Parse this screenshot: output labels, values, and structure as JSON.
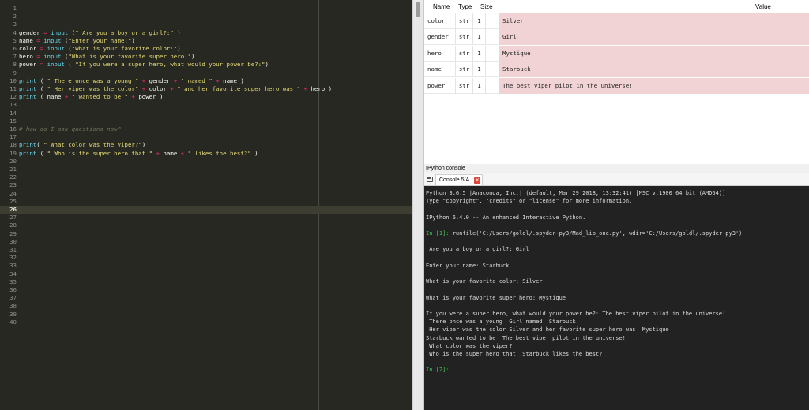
{
  "editor": {
    "current_line": 26,
    "lines": [
      {
        "n": "1",
        "tokens": []
      },
      {
        "n": "2",
        "tokens": []
      },
      {
        "n": "3",
        "tokens": []
      },
      {
        "n": "4",
        "tokens": [
          {
            "t": "gender ",
            "c": "t"
          },
          {
            "t": "=",
            "c": "o"
          },
          {
            "t": " ",
            "c": "t"
          },
          {
            "t": "input",
            "c": "k"
          },
          {
            "t": " (",
            "c": "t"
          },
          {
            "t": "\" Are you a boy or a girl?:\"",
            "c": "s"
          },
          {
            "t": " )",
            "c": "t"
          }
        ]
      },
      {
        "n": "5",
        "tokens": [
          {
            "t": "name ",
            "c": "t"
          },
          {
            "t": "=",
            "c": "o"
          },
          {
            "t": " ",
            "c": "t"
          },
          {
            "t": "input",
            "c": "k"
          },
          {
            "t": " (",
            "c": "t"
          },
          {
            "t": "\"Enter your name:\"",
            "c": "s"
          },
          {
            "t": ")",
            "c": "t"
          }
        ]
      },
      {
        "n": "6",
        "tokens": [
          {
            "t": "color ",
            "c": "t"
          },
          {
            "t": "=",
            "c": "o"
          },
          {
            "t": " ",
            "c": "t"
          },
          {
            "t": "input",
            "c": "k"
          },
          {
            "t": " (",
            "c": "t"
          },
          {
            "t": "\"What is your favorite color:\"",
            "c": "s"
          },
          {
            "t": ")",
            "c": "t"
          }
        ]
      },
      {
        "n": "7",
        "tokens": [
          {
            "t": "hero ",
            "c": "t"
          },
          {
            "t": "=",
            "c": "o"
          },
          {
            "t": " ",
            "c": "t"
          },
          {
            "t": "input",
            "c": "k"
          },
          {
            "t": " (",
            "c": "t"
          },
          {
            "t": "\"What is your favorite super hero:\"",
            "c": "s"
          },
          {
            "t": ")",
            "c": "t"
          }
        ]
      },
      {
        "n": "8",
        "tokens": [
          {
            "t": "power ",
            "c": "t"
          },
          {
            "t": "=",
            "c": "o"
          },
          {
            "t": " ",
            "c": "t"
          },
          {
            "t": "input",
            "c": "k"
          },
          {
            "t": " ( ",
            "c": "t"
          },
          {
            "t": "\"If you were a super hero, what would your power be?:\"",
            "c": "s"
          },
          {
            "t": ")",
            "c": "t"
          }
        ]
      },
      {
        "n": "9",
        "tokens": []
      },
      {
        "n": "10",
        "tokens": [
          {
            "t": "print",
            "c": "k"
          },
          {
            "t": " ( ",
            "c": "t"
          },
          {
            "t": "\" There once was a young \"",
            "c": "s"
          },
          {
            "t": " ",
            "c": "t"
          },
          {
            "t": "+",
            "c": "o"
          },
          {
            "t": " gender ",
            "c": "t"
          },
          {
            "t": "+",
            "c": "o"
          },
          {
            "t": " ",
            "c": "t"
          },
          {
            "t": "\" named \"",
            "c": "s"
          },
          {
            "t": " ",
            "c": "t"
          },
          {
            "t": "+",
            "c": "o"
          },
          {
            "t": " name )",
            "c": "t"
          }
        ]
      },
      {
        "n": "11",
        "tokens": [
          {
            "t": "print",
            "c": "k"
          },
          {
            "t": " ( ",
            "c": "t"
          },
          {
            "t": "\" Her viper was the color\"",
            "c": "s"
          },
          {
            "t": " ",
            "c": "t"
          },
          {
            "t": "+",
            "c": "o"
          },
          {
            "t": " color ",
            "c": "t"
          },
          {
            "t": "+",
            "c": "o"
          },
          {
            "t": " ",
            "c": "t"
          },
          {
            "t": "\" and her favorite super hero was \"",
            "c": "s"
          },
          {
            "t": " ",
            "c": "t"
          },
          {
            "t": "+",
            "c": "o"
          },
          {
            "t": " hero )",
            "c": "t"
          }
        ]
      },
      {
        "n": "12",
        "tokens": [
          {
            "t": "print",
            "c": "k"
          },
          {
            "t": " ( name ",
            "c": "t"
          },
          {
            "t": "+",
            "c": "o"
          },
          {
            "t": " ",
            "c": "t"
          },
          {
            "t": "\" wanted to be \"",
            "c": "s"
          },
          {
            "t": " ",
            "c": "t"
          },
          {
            "t": "+",
            "c": "o"
          },
          {
            "t": " power )",
            "c": "t"
          }
        ]
      },
      {
        "n": "13",
        "tokens": []
      },
      {
        "n": "14",
        "tokens": []
      },
      {
        "n": "15",
        "tokens": []
      },
      {
        "n": "16",
        "tokens": [
          {
            "t": "# how do I ask questions now?",
            "c": "c"
          }
        ]
      },
      {
        "n": "17",
        "tokens": []
      },
      {
        "n": "18",
        "tokens": [
          {
            "t": "print",
            "c": "k"
          },
          {
            "t": "( ",
            "c": "t"
          },
          {
            "t": "\" What color was the viper?\"",
            "c": "s"
          },
          {
            "t": ")",
            "c": "t"
          }
        ]
      },
      {
        "n": "19",
        "tokens": [
          {
            "t": "print",
            "c": "k"
          },
          {
            "t": " ( ",
            "c": "t"
          },
          {
            "t": "\" Who is the super hero that \"",
            "c": "s"
          },
          {
            "t": " ",
            "c": "t"
          },
          {
            "t": "+",
            "c": "o"
          },
          {
            "t": " name ",
            "c": "t"
          },
          {
            "t": "+",
            "c": "o"
          },
          {
            "t": " ",
            "c": "t"
          },
          {
            "t": "\" likes the best?\"",
            "c": "s"
          },
          {
            "t": " )",
            "c": "t"
          }
        ]
      },
      {
        "n": "20",
        "tokens": []
      },
      {
        "n": "21",
        "tokens": []
      },
      {
        "n": "22",
        "tokens": []
      },
      {
        "n": "23",
        "tokens": []
      },
      {
        "n": "24",
        "tokens": []
      },
      {
        "n": "25",
        "tokens": []
      },
      {
        "n": "26",
        "tokens": []
      },
      {
        "n": "27",
        "tokens": []
      },
      {
        "n": "28",
        "tokens": []
      },
      {
        "n": "29",
        "tokens": []
      },
      {
        "n": "30",
        "tokens": []
      },
      {
        "n": "31",
        "tokens": []
      },
      {
        "n": "32",
        "tokens": []
      },
      {
        "n": "33",
        "tokens": []
      },
      {
        "n": "34",
        "tokens": []
      },
      {
        "n": "35",
        "tokens": []
      },
      {
        "n": "36",
        "tokens": []
      },
      {
        "n": "37",
        "tokens": []
      },
      {
        "n": "38",
        "tokens": []
      },
      {
        "n": "39",
        "tokens": []
      },
      {
        "n": "40",
        "tokens": []
      }
    ]
  },
  "variable_explorer": {
    "headers": {
      "name": "Name",
      "type": "Type",
      "size": "Size",
      "value": "Value"
    },
    "rows": [
      {
        "name": "color",
        "type": "str",
        "size": "1",
        "value": "Silver"
      },
      {
        "name": "gender",
        "type": "str",
        "size": "1",
        "value": "Girl"
      },
      {
        "name": "hero",
        "type": "str",
        "size": "1",
        "value": "Mystique"
      },
      {
        "name": "name",
        "type": "str",
        "size": "1",
        "value": "Starbuck"
      },
      {
        "name": "power",
        "type": "str",
        "size": "1",
        "value": "The best viper pilot in the universe!"
      }
    ]
  },
  "console": {
    "pane_title": "IPython console",
    "tab_label": "Console 5/A",
    "lines": [
      {
        "text": "Python 3.6.5 |Anaconda, Inc.| (default, Mar 29 2018, 13:32:41) [MSC v.1900 64 bit (AMD64)]",
        "kind": "text"
      },
      {
        "text": "Type \"copyright\", \"credits\" or \"license\" for more information.",
        "kind": "text"
      },
      {
        "text": "",
        "kind": "text"
      },
      {
        "text": "IPython 6.4.0 -- An enhanced Interactive Python.",
        "kind": "text"
      },
      {
        "text": "",
        "kind": "text"
      },
      {
        "prompt": "In [1]: ",
        "text": "runfile('C:/Users/goldl/.spyder-py3/Mad_lib_one.py', wdir='C:/Users/goldl/.spyder-py3')",
        "kind": "prompt"
      },
      {
        "text": "",
        "kind": "text"
      },
      {
        "text": " Are you a boy or a girl?: Girl",
        "kind": "text"
      },
      {
        "text": "",
        "kind": "text"
      },
      {
        "text": "Enter your name: Starbuck",
        "kind": "text"
      },
      {
        "text": "",
        "kind": "text"
      },
      {
        "text": "What is your favorite color: Silver",
        "kind": "text"
      },
      {
        "text": "",
        "kind": "text"
      },
      {
        "text": "What is your favorite super hero: Mystique",
        "kind": "text"
      },
      {
        "text": "",
        "kind": "text"
      },
      {
        "text": "If you were a super hero, what would your power be?: The best viper pilot in the universe!",
        "kind": "text"
      },
      {
        "text": " There once was a young  Girl named  Starbuck",
        "kind": "text"
      },
      {
        "text": " Her viper was the color Silver and her favorite super hero was  Mystique",
        "kind": "text"
      },
      {
        "text": "Starbuck wanted to be  The best viper pilot in the universe!",
        "kind": "text"
      },
      {
        "text": " What color was the viper?",
        "kind": "text"
      },
      {
        "text": " Who is the super hero that  Starbuck likes the best?",
        "kind": "text"
      },
      {
        "text": "",
        "kind": "text"
      },
      {
        "prompt": "In [2]: ",
        "text": "",
        "kind": "prompt"
      }
    ]
  }
}
